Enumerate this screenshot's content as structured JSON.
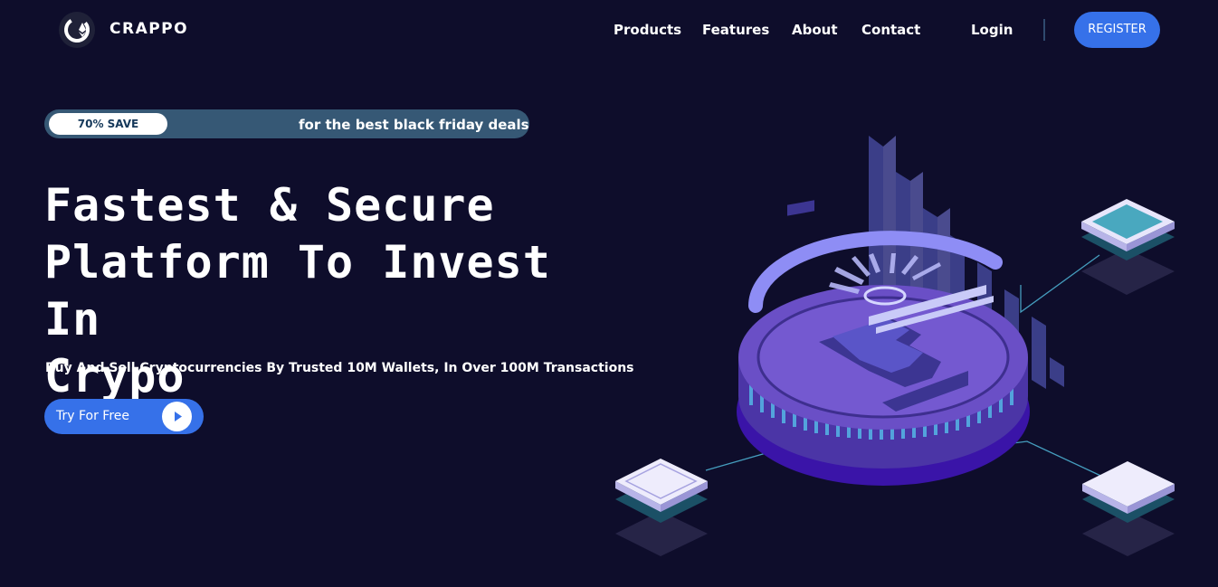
{
  "nav": {
    "brand": "CRAPPO",
    "links": [
      "Products",
      "Features",
      "About",
      "Contact"
    ],
    "login": "Login",
    "register": "REGISTER"
  },
  "promo": {
    "badge": "70% SAVE",
    "text": "for the best black friday deals"
  },
  "hero": {
    "headline_lines": [
      "Fastest & Secure",
      "Platform To Invest In",
      "Crypo"
    ],
    "subline": "Buy And Sell Cryptocurrencies By Trusted 10M Wallets, In Over 100M Transactions",
    "cta": "Try For Free"
  },
  "colors": {
    "background": "#0e0d2b",
    "accent": "#3671e9",
    "promo_bar": "#365875",
    "coin": "#6a4fc6"
  },
  "icons": {
    "logo": "ethereum-logo-icon",
    "cta": "play-icon",
    "illustration": "bitcoin-coin-illustration"
  }
}
